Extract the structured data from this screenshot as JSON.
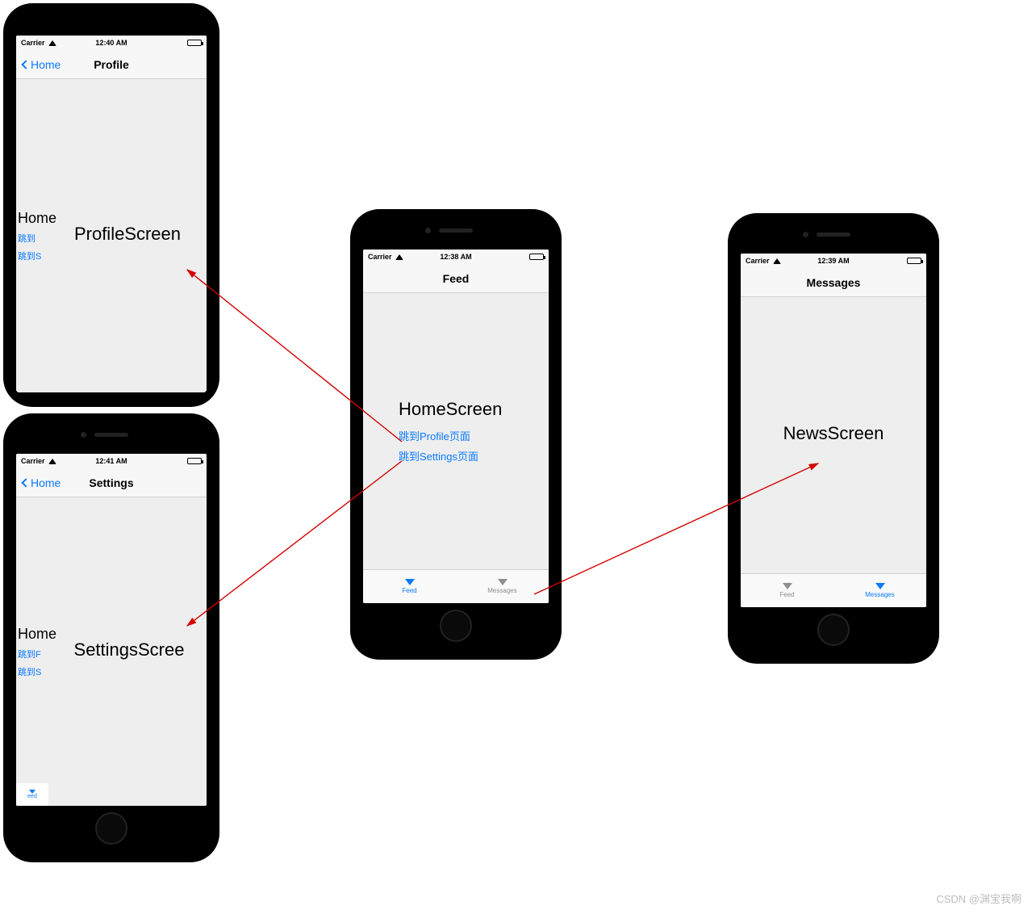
{
  "colors": {
    "iosBlue": "#0a7aff",
    "bgLight": "#eeeeee"
  },
  "phoneA": {
    "status": {
      "carrier": "Carrier",
      "time": "12:40 AM"
    },
    "nav": {
      "back": "Home",
      "title": "Profile"
    },
    "peek": {
      "title": "Home",
      "link1": "跳到",
      "link2": "跳到S"
    },
    "main": {
      "title": "ProfileScreen"
    }
  },
  "phoneB": {
    "status": {
      "carrier": "Carrier",
      "time": "12:41 AM"
    },
    "nav": {
      "back": "Home",
      "title": "Settings"
    },
    "peek": {
      "title": "Home",
      "link1": "跳到F",
      "link2": "跳到S",
      "tabLabel": "eed"
    },
    "main": {
      "title": "SettingsScree"
    }
  },
  "phoneC": {
    "status": {
      "carrier": "Carrier",
      "time": "12:38 AM"
    },
    "nav": {
      "title": "Feed"
    },
    "main": {
      "title": "HomeScreen",
      "link1": "跳到Profile页面",
      "link2": "跳到Settings页面"
    },
    "tabs": [
      {
        "label": "Feed",
        "active": true
      },
      {
        "label": "Messages",
        "active": false
      }
    ]
  },
  "phoneD": {
    "status": {
      "carrier": "Carrier",
      "time": "12:39 AM"
    },
    "nav": {
      "title": "Messages"
    },
    "main": {
      "title": "NewsScreen"
    },
    "tabs": [
      {
        "label": "Feed",
        "active": false
      },
      {
        "label": "Messages",
        "active": true
      }
    ]
  },
  "watermark": "CSDN @渊宝我啊"
}
